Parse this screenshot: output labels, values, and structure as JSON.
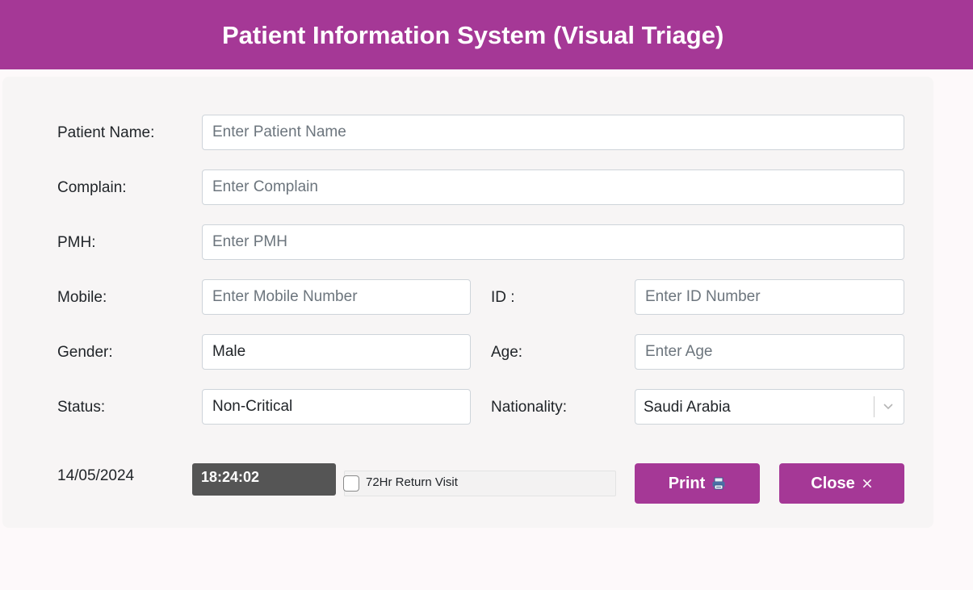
{
  "header": {
    "title": "Patient Information System (Visual Triage)"
  },
  "form": {
    "patient_name": {
      "label": "Patient Name:",
      "placeholder": "Enter Patient Name",
      "value": ""
    },
    "complain": {
      "label": "Complain:",
      "placeholder": "Enter Complain",
      "value": ""
    },
    "pmh": {
      "label": "PMH:",
      "placeholder": "Enter PMH",
      "value": ""
    },
    "mobile": {
      "label": "Mobile:",
      "placeholder": "Enter Mobile Number",
      "value": ""
    },
    "id": {
      "label": "ID :",
      "placeholder": "Enter ID Number",
      "value": ""
    },
    "gender": {
      "label": "Gender:",
      "value": "Male"
    },
    "age": {
      "label": "Age:",
      "placeholder": "Enter Age",
      "value": ""
    },
    "status": {
      "label": "Status:",
      "value": "Non-Critical"
    },
    "nationality": {
      "label": "Nationality:",
      "value": "Saudi Arabia"
    }
  },
  "footer": {
    "date": "14/05/2024",
    "time": "18:24:02",
    "return_visit_label": "72Hr Return Visit",
    "return_visit_checked": false,
    "print_label": "Print",
    "close_label": "Close"
  },
  "colors": {
    "accent": "#a53896",
    "time_bg": "#555555",
    "card_bg": "#f7f5f5"
  },
  "icons": {
    "print": "printer-icon",
    "close": "close-icon",
    "dropdown": "chevron-down-icon"
  }
}
